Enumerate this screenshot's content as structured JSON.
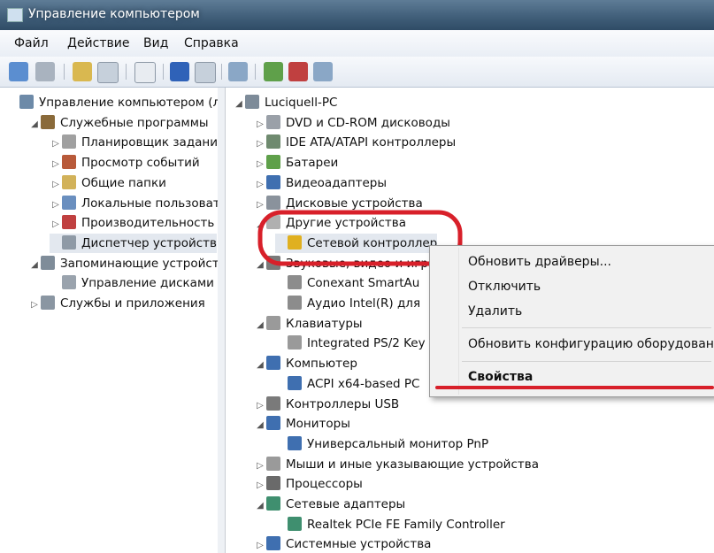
{
  "window": {
    "title": "Управление компьютером"
  },
  "menu": [
    "Файл",
    "Действие",
    "Вид",
    "Справка"
  ],
  "left_tree": [
    {
      "label": "Управление компьютером (л",
      "arrow": "",
      "indent": 0,
      "icon": "computer-management-icon",
      "color": "#6d8aa8"
    },
    {
      "label": "Служебные программы",
      "arrow": "◢",
      "indent": 1,
      "icon": "tools-icon",
      "color": "#8a6a3a"
    },
    {
      "label": "Планировщик заданий",
      "arrow": "▷",
      "indent": 2,
      "icon": "task-scheduler-icon",
      "color": "#a0a0a0"
    },
    {
      "label": "Просмотр событий",
      "arrow": "▷",
      "indent": 2,
      "icon": "event-viewer-icon",
      "color": "#b85a3a"
    },
    {
      "label": "Общие папки",
      "arrow": "▷",
      "indent": 2,
      "icon": "shared-folders-icon",
      "color": "#d2b25a"
    },
    {
      "label": "Локальные пользовате",
      "arrow": "▷",
      "indent": 2,
      "icon": "local-users-icon",
      "color": "#6a8fbf"
    },
    {
      "label": "Производительность",
      "arrow": "▷",
      "indent": 2,
      "icon": "performance-icon",
      "color": "#c04040"
    },
    {
      "label": "Диспетчер устройств",
      "arrow": "",
      "indent": 2,
      "icon": "device-manager-icon",
      "color": "#8f9aa6",
      "selected": true
    },
    {
      "label": "Запоминающие устройст",
      "arrow": "◢",
      "indent": 1,
      "icon": "storage-icon",
      "color": "#7f8c99"
    },
    {
      "label": "Управление дисками",
      "arrow": "",
      "indent": 2,
      "icon": "disk-management-icon",
      "color": "#9aa3ad"
    },
    {
      "label": "Службы и приложения",
      "arrow": "▷",
      "indent": 1,
      "icon": "services-icon",
      "color": "#8a96a2"
    }
  ],
  "right_tree": [
    {
      "label": "Luciquell-PC",
      "arrow": "◢",
      "indent": 0,
      "icon": "computer-icon",
      "color": "#7d8b99"
    },
    {
      "label": "DVD и CD-ROM дисководы",
      "arrow": "▷",
      "indent": 1,
      "icon": "dvd-drive-icon",
      "color": "#9aa0a8"
    },
    {
      "label": "IDE ATA/ATAPI контроллеры",
      "arrow": "▷",
      "indent": 1,
      "icon": "ide-controller-icon",
      "color": "#6f8a6f"
    },
    {
      "label": "Батареи",
      "arrow": "▷",
      "indent": 1,
      "icon": "battery-icon",
      "color": "#5fa04a"
    },
    {
      "label": "Видеоадаптеры",
      "arrow": "▷",
      "indent": 1,
      "icon": "display-adapter-icon",
      "color": "#3f6fb0"
    },
    {
      "label": "Дисковые устройства",
      "arrow": "▷",
      "indent": 1,
      "icon": "disk-drive-icon",
      "color": "#8a929c"
    },
    {
      "label": "Другие устройства",
      "arrow": "◢",
      "indent": 1,
      "icon": "unknown-device-icon",
      "color": "#b0b0b0"
    },
    {
      "label": "Сетевой контроллер",
      "arrow": "",
      "indent": 2,
      "icon": "warning-device-icon",
      "color": "#e0b020",
      "selected": true
    },
    {
      "label": "Звуковые, видео и игро",
      "arrow": "◢",
      "indent": 1,
      "icon": "sound-icon",
      "color": "#7a7a7a"
    },
    {
      "label": "Conexant SmartAu",
      "arrow": "",
      "indent": 2,
      "icon": "speaker-icon",
      "color": "#8c8c8c"
    },
    {
      "label": "Аудио Intel(R) для",
      "arrow": "",
      "indent": 2,
      "icon": "speaker-icon",
      "color": "#8c8c8c"
    },
    {
      "label": "Клавиатуры",
      "arrow": "◢",
      "indent": 1,
      "icon": "keyboard-icon",
      "color": "#9a9a9a"
    },
    {
      "label": "Integrated PS/2 Key",
      "arrow": "",
      "indent": 2,
      "icon": "keyboard-icon",
      "color": "#9a9a9a"
    },
    {
      "label": "Компьютер",
      "arrow": "◢",
      "indent": 1,
      "icon": "computer-icon",
      "color": "#3f6fb0"
    },
    {
      "label": "ACPI x64-based PC",
      "arrow": "",
      "indent": 2,
      "icon": "computer-icon",
      "color": "#3f6fb0"
    },
    {
      "label": "Контроллеры USB",
      "arrow": "▷",
      "indent": 1,
      "icon": "usb-icon",
      "color": "#7a7a7a"
    },
    {
      "label": "Мониторы",
      "arrow": "◢",
      "indent": 1,
      "icon": "monitor-icon",
      "color": "#3f6fb0"
    },
    {
      "label": "Универсальный монитор PnP",
      "arrow": "",
      "indent": 2,
      "icon": "monitor-icon",
      "color": "#3f6fb0"
    },
    {
      "label": "Мыши и иные указывающие устройства",
      "arrow": "▷",
      "indent": 1,
      "icon": "mouse-icon",
      "color": "#9a9a9a"
    },
    {
      "label": "Процессоры",
      "arrow": "▷",
      "indent": 1,
      "icon": "processor-icon",
      "color": "#6a6a6a"
    },
    {
      "label": "Сетевые адаптеры",
      "arrow": "◢",
      "indent": 1,
      "icon": "network-adapter-icon",
      "color": "#3f8f6f"
    },
    {
      "label": "Realtek PCIe FE Family Controller",
      "arrow": "",
      "indent": 2,
      "icon": "network-adapter-icon",
      "color": "#3f8f6f"
    },
    {
      "label": "Системные устройства",
      "arrow": "▷",
      "indent": 1,
      "icon": "system-devices-icon",
      "color": "#3f6fb0"
    }
  ],
  "context_menu": [
    {
      "label": "Обновить драйверы...",
      "bold": false
    },
    {
      "label": "Отключить",
      "bold": false
    },
    {
      "label": "Удалить",
      "bold": false
    },
    {
      "label": "Обновить конфигурацию оборудования",
      "bold": false
    },
    {
      "label": "Свойства",
      "bold": true
    }
  ],
  "toolbar_icons": [
    "back-icon",
    "forward-icon",
    "up-folder-icon",
    "show-hide-tree-icon",
    "properties-icon",
    "help-icon",
    "view-icon",
    "scan-hardware-icon",
    "update-driver-icon",
    "uninstall-icon",
    "disable-icon"
  ],
  "annotations": {
    "highlight_color": "#d8202a"
  }
}
